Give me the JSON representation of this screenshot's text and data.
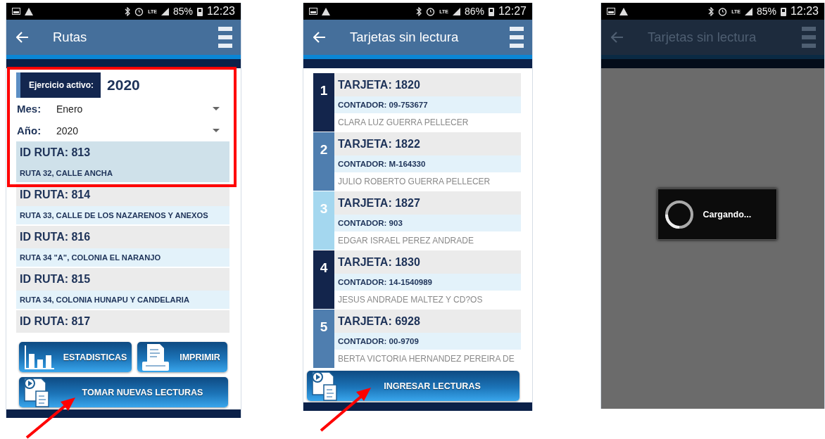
{
  "screens": [
    {
      "kind": "routes",
      "status_bar": {
        "network": "LTE",
        "battery": "85%",
        "time": "12:23"
      },
      "header": {
        "title": "Rutas"
      },
      "exercise": {
        "label": "Ejercicio activo:",
        "year": "2020"
      },
      "filters": [
        {
          "label": "Mes:",
          "value": "Enero"
        },
        {
          "label": "Año:",
          "value": "2020"
        }
      ],
      "routes": [
        {
          "id": "ID RUTA: 813",
          "name": "RUTA 32, CALLE ANCHA",
          "selected": true
        },
        {
          "id": "ID RUTA: 814",
          "name": "RUTA 33, CALLE DE LOS NAZARENOS Y ANEXOS",
          "selected": false
        },
        {
          "id": "ID RUTA: 816",
          "name": "RUTA 34 \"A\", COLONIA EL NARANJO",
          "selected": false
        },
        {
          "id": "ID RUTA: 815",
          "name": "RUTA 34, COLONIA HUNAPU Y CANDELARIA",
          "selected": false
        },
        {
          "id": "ID RUTA: 817",
          "selected": false
        }
      ],
      "buttons": [
        {
          "kind": "stats",
          "label": "ESTADISTICAS"
        },
        {
          "kind": "print",
          "label": "IMPRIMIR"
        },
        {
          "kind": "readings",
          "label": "TOMAR NUEVAS LECTURAS"
        }
      ]
    },
    {
      "kind": "cards",
      "status_bar": {
        "network": "LTE",
        "battery": "86%",
        "time": "12:27"
      },
      "header": {
        "title": "Tarjetas sin lectura"
      },
      "cards": [
        {
          "number": "1",
          "card": "TARJETA: 1820",
          "meter": "CONTADOR: 09-753677",
          "owner": "CLARA LUZ GUERRA PELLECER",
          "color": "#13254c"
        },
        {
          "number": "2",
          "card": "TARJETA: 1822",
          "meter": "CONTADOR: M-164330",
          "owner": "JULIO ROBERTO GUERRA PELLECER",
          "color": "#4f7eaf"
        },
        {
          "number": "3",
          "card": "TARJETA: 1827",
          "meter": "CONTADOR: 903",
          "owner": "EDGAR ISRAEL PEREZ ANDRADE",
          "color": "#a4d7ef"
        },
        {
          "number": "4",
          "card": "TARJETA: 1830",
          "meter": "CONTADOR: 14-1540989",
          "owner": "JESUS ANDRADE MALTEZ Y CD?OS",
          "color": "#13254c"
        },
        {
          "number": "5",
          "card": "TARJETA: 6928",
          "meter": "CONTADOR: 00-9709",
          "owner": "BERTA VICTORIA HERNANDEZ PEREIRA DE",
          "color": "#4f7eaf"
        }
      ],
      "buttons": [
        {
          "kind": "readings",
          "label": "INGRESAR LECTURAS"
        }
      ]
    },
    {
      "kind": "loading",
      "status_bar": {
        "network": "LTE",
        "battery": "85%",
        "time": "12:23"
      },
      "header": {
        "title": "Tarjetas sin lectura"
      },
      "dialog": {
        "message": "Cargando..."
      }
    }
  ]
}
